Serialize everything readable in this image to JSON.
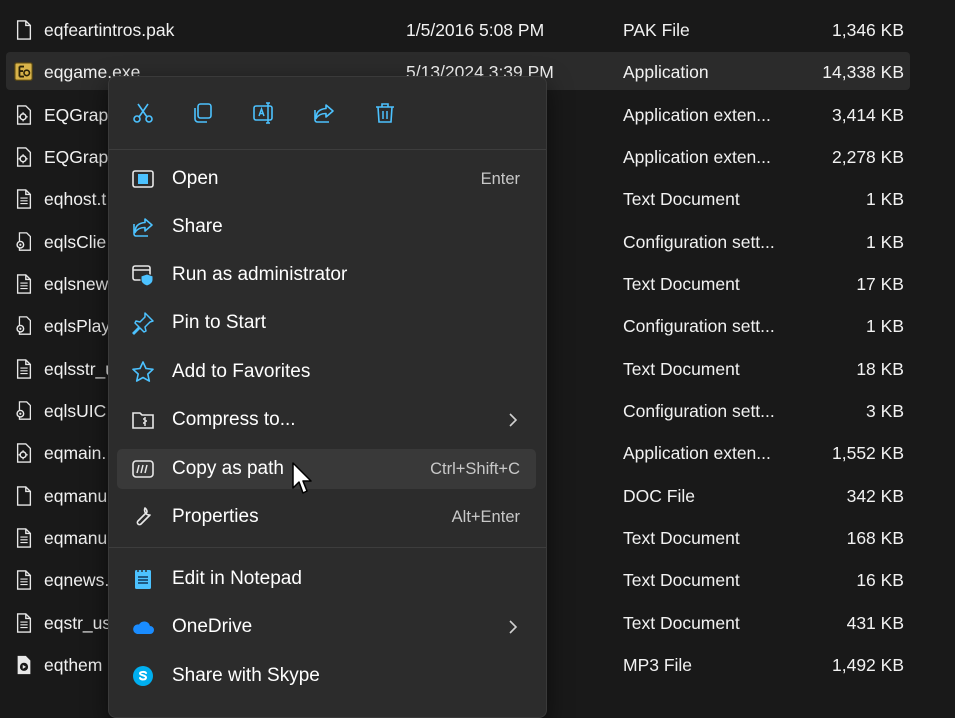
{
  "files": [
    {
      "name": "eqfeartintros.pak",
      "date": "1/5/2016 5:08 PM",
      "type": "PAK File",
      "size": "1,346 KB",
      "icon": "document-icon"
    },
    {
      "name": "eqgame.exe",
      "date": "5/13/2024 3:39 PM",
      "type": "Application",
      "size": "14,338 KB",
      "icon": "app-exe-icon",
      "selected": true
    },
    {
      "name": "EQGrapl",
      "date": "M",
      "type": "Application exten...",
      "size": "3,414 KB",
      "icon": "dll-icon"
    },
    {
      "name": "EQGrapl",
      "date": "AM",
      "type": "Application exten...",
      "size": "2,278 KB",
      "icon": "dll-icon"
    },
    {
      "name": "eqhost.t",
      "date": "",
      "type": "Text Document",
      "size": "1 KB",
      "icon": "text-file-icon"
    },
    {
      "name": "eqlsClie",
      "date": "M",
      "type": "Configuration sett...",
      "size": "1 KB",
      "icon": "config-file-icon"
    },
    {
      "name": "eqlsnew",
      "date": "M",
      "type": "Text Document",
      "size": "17 KB",
      "icon": "text-file-icon"
    },
    {
      "name": "eqlsPlay",
      "date": "M",
      "type": "Configuration sett...",
      "size": "1 KB",
      "icon": "config-file-icon"
    },
    {
      "name": "eqlsstr_u",
      "date": "M",
      "type": "Text Document",
      "size": "18 KB",
      "icon": "text-file-icon"
    },
    {
      "name": "eqlsUIC",
      "date": "M",
      "type": "Configuration sett...",
      "size": "3 KB",
      "icon": "config-file-icon"
    },
    {
      "name": "eqmain.",
      "date": "M",
      "type": "Application exten...",
      "size": "1,552 KB",
      "icon": "dll-icon"
    },
    {
      "name": "eqmanu",
      "date": "",
      "type": "DOC File",
      "size": "342 KB",
      "icon": "document-icon"
    },
    {
      "name": "eqmanu",
      "date": "",
      "type": "Text Document",
      "size": "168 KB",
      "icon": "text-file-icon"
    },
    {
      "name": "eqnews.",
      "date": "M",
      "type": "Text Document",
      "size": "16 KB",
      "icon": "text-file-icon"
    },
    {
      "name": "eqstr_us",
      "date": "M",
      "type": "Text Document",
      "size": "431 KB",
      "icon": "text-file-icon"
    },
    {
      "name": "eqthem",
      "date": "M",
      "type": "MP3 File",
      "size": "1,492 KB",
      "icon": "media-file-icon"
    }
  ],
  "context_menu": {
    "quick_actions": [
      {
        "name": "cut",
        "icon": "scissors-icon"
      },
      {
        "name": "copy",
        "icon": "copy-icon"
      },
      {
        "name": "rename",
        "icon": "rename-icon"
      },
      {
        "name": "share",
        "icon": "share-icon"
      },
      {
        "name": "delete",
        "icon": "trash-icon"
      }
    ],
    "items": [
      {
        "label": "Open",
        "shortcut": "Enter",
        "icon": "open-app-icon"
      },
      {
        "label": "Share",
        "shortcut": "",
        "icon": "share-icon"
      },
      {
        "label": "Run as administrator",
        "shortcut": "",
        "icon": "shield-icon"
      },
      {
        "label": "Pin to Start",
        "shortcut": "",
        "icon": "pin-icon"
      },
      {
        "label": "Add to Favorites",
        "shortcut": "",
        "icon": "star-icon"
      },
      {
        "label": "Compress to...",
        "shortcut": "",
        "icon": "zip-folder-icon",
        "submenu": true
      },
      {
        "label": "Copy as path",
        "shortcut": "Ctrl+Shift+C",
        "icon": "copy-path-icon",
        "hover": true
      },
      {
        "label": "Properties",
        "shortcut": "Alt+Enter",
        "icon": "wrench-icon"
      },
      {
        "label": "Edit in Notepad",
        "shortcut": "",
        "icon": "notepad-icon"
      },
      {
        "label": "OneDrive",
        "shortcut": "",
        "icon": "onedrive-cloud-icon",
        "submenu": true
      },
      {
        "label": "Share with Skype",
        "shortcut": "",
        "icon": "skype-icon"
      }
    ]
  },
  "colors": {
    "background": "#191919",
    "menu_background": "#2c2c2c",
    "accent": "#4cc2ff",
    "onedrive": "#1a8cff",
    "skype": "#00aff0"
  }
}
